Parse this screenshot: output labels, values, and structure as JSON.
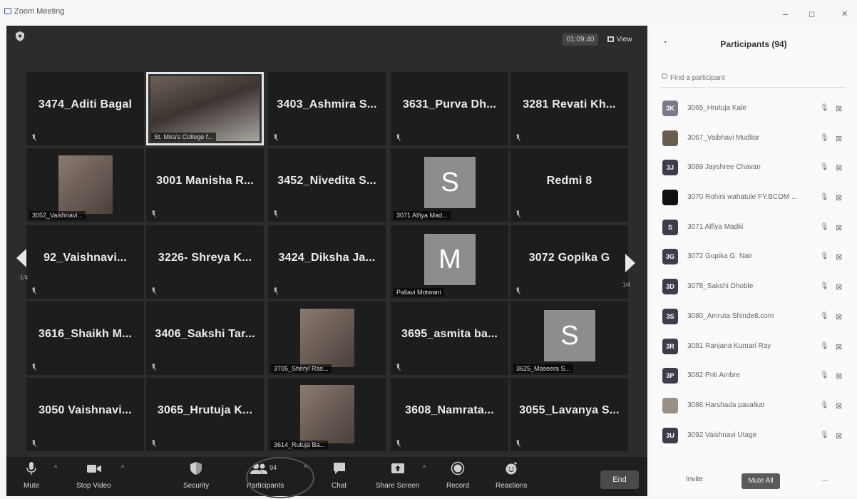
{
  "window": {
    "title": "Zoom Meeting",
    "min": "–",
    "max": "◻",
    "close": "✕"
  },
  "meeting": {
    "timer": "01:09:40",
    "view_label": "View",
    "page_left": "1/4",
    "page_right": "1/4",
    "tiles": [
      {
        "name": "3474_Aditi Bagal"
      },
      {
        "label": "St. Mira's College f..."
      },
      {
        "name": "3403_Ashmira S..."
      },
      {
        "name": "3631_Purva Dh..."
      },
      {
        "name": "3281 Revati Kh..."
      },
      {
        "label": "3052_Vaishnavi..."
      },
      {
        "name": "3001 Manisha R..."
      },
      {
        "name": "3452_Nivedita S..."
      },
      {
        "avatar": "S",
        "label": "3071 Alfiya Mad..."
      },
      {
        "name": "Redmi 8"
      },
      {
        "name": "92_Vaishnavi..."
      },
      {
        "name": "3226- Shreya K..."
      },
      {
        "name": "3424_Diksha Ja..."
      },
      {
        "avatar": "M",
        "label": "Pallavi Motwani"
      },
      {
        "name": "3072 Gopika G"
      },
      {
        "name": "3616_Shaikh M..."
      },
      {
        "name": "3406_Sakshi Tar..."
      },
      {
        "label": "3705_Sheryl Ras..."
      },
      {
        "name": "3695_asmita ba..."
      },
      {
        "avatar": "S",
        "label": "3625_Maseera S..."
      },
      {
        "name": "3050 Vaishnavi..."
      },
      {
        "name": "3065_Hrutuja K..."
      },
      {
        "label": "3614_Rutuja Ba..."
      },
      {
        "name": "3608_Namrata..."
      },
      {
        "name": "3055_Lavanya S..."
      }
    ]
  },
  "toolbar": {
    "mute": "Mute",
    "stop_video": "Stop Video",
    "security": "Security",
    "participants": "Participants",
    "participants_count": "94",
    "chat": "Chat",
    "share_screen": "Share Screen",
    "record": "Record",
    "reactions": "Reactions",
    "end": "End"
  },
  "panel": {
    "title": "Participants (94)",
    "search_placeholder": "Find a participant",
    "invite": "Invite",
    "mute_all": "Mute All",
    "more": "...",
    "participants": [
      {
        "initials": "3K",
        "name": "3065_Hrutuja Kale",
        "color": "#7a7a8c"
      },
      {
        "initials": "",
        "name": "3067_Vaibhavi Mudliar",
        "color": "#6b5c50"
      },
      {
        "initials": "3J",
        "name": "3069 Jayshree Chavan",
        "color": "#3c3c4c"
      },
      {
        "initials": "",
        "name": "3070 Rohini wahatule FY.BCOM ...",
        "color": "#111111"
      },
      {
        "initials": "S",
        "name": "3071 Alfiya Madki",
        "color": "#3c3c4c"
      },
      {
        "initials": "3G",
        "name": "3072 Gopika G. Nair",
        "color": "#3c3c4c"
      },
      {
        "initials": "3D",
        "name": "3078_Sakshi Dhoble",
        "color": "#3c3c4c"
      },
      {
        "initials": "3S",
        "name": "3080_Amruta Shinde8.com",
        "color": "#3c3c4c"
      },
      {
        "initials": "3R",
        "name": "3081 Ranjana Kumari Ray",
        "color": "#3c3c4c"
      },
      {
        "initials": "3P",
        "name": "3082 Priti Ambre",
        "color": "#3c3c4c"
      },
      {
        "initials": "",
        "name": "3086 Harshada pasalkar",
        "color": "#9a8f86"
      },
      {
        "initials": "3U",
        "name": "3092 Vaishnavi Utage",
        "color": "#3c3c4c"
      }
    ]
  }
}
